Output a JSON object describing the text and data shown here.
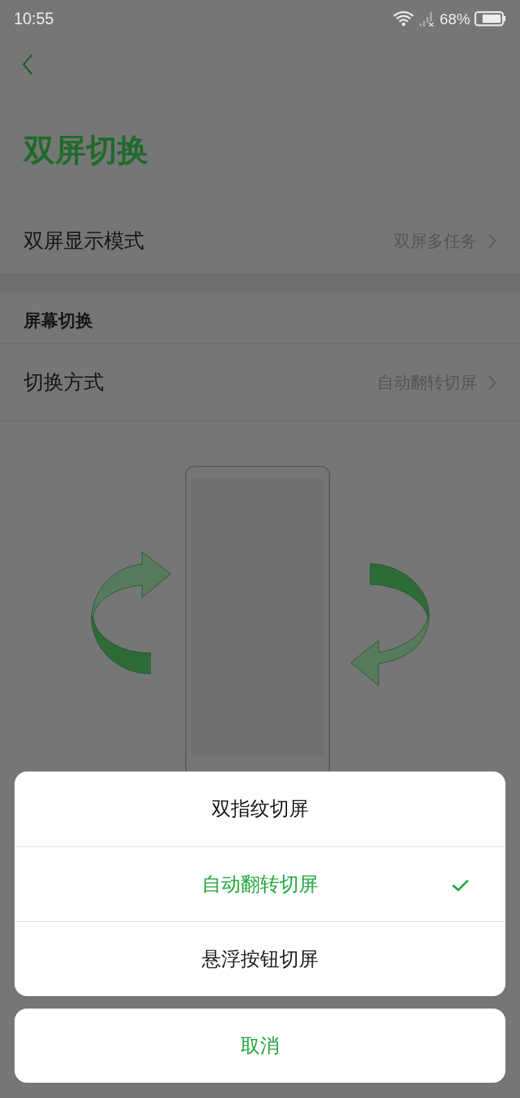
{
  "status_bar": {
    "time": "10:55",
    "battery": "68%"
  },
  "title": "双屏切换",
  "settings": [
    {
      "label": "双屏显示模式",
      "value": "双屏多任务"
    }
  ],
  "section": {
    "header": "屏幕切换",
    "rows": [
      {
        "label": "切换方式",
        "value": "自动翻转切屏"
      }
    ]
  },
  "action_sheet": {
    "options": [
      {
        "label": "双指纹切屏",
        "selected": false
      },
      {
        "label": "自动翻转切屏",
        "selected": true
      },
      {
        "label": "悬浮按钮切屏",
        "selected": false
      }
    ],
    "cancel": "取消"
  }
}
